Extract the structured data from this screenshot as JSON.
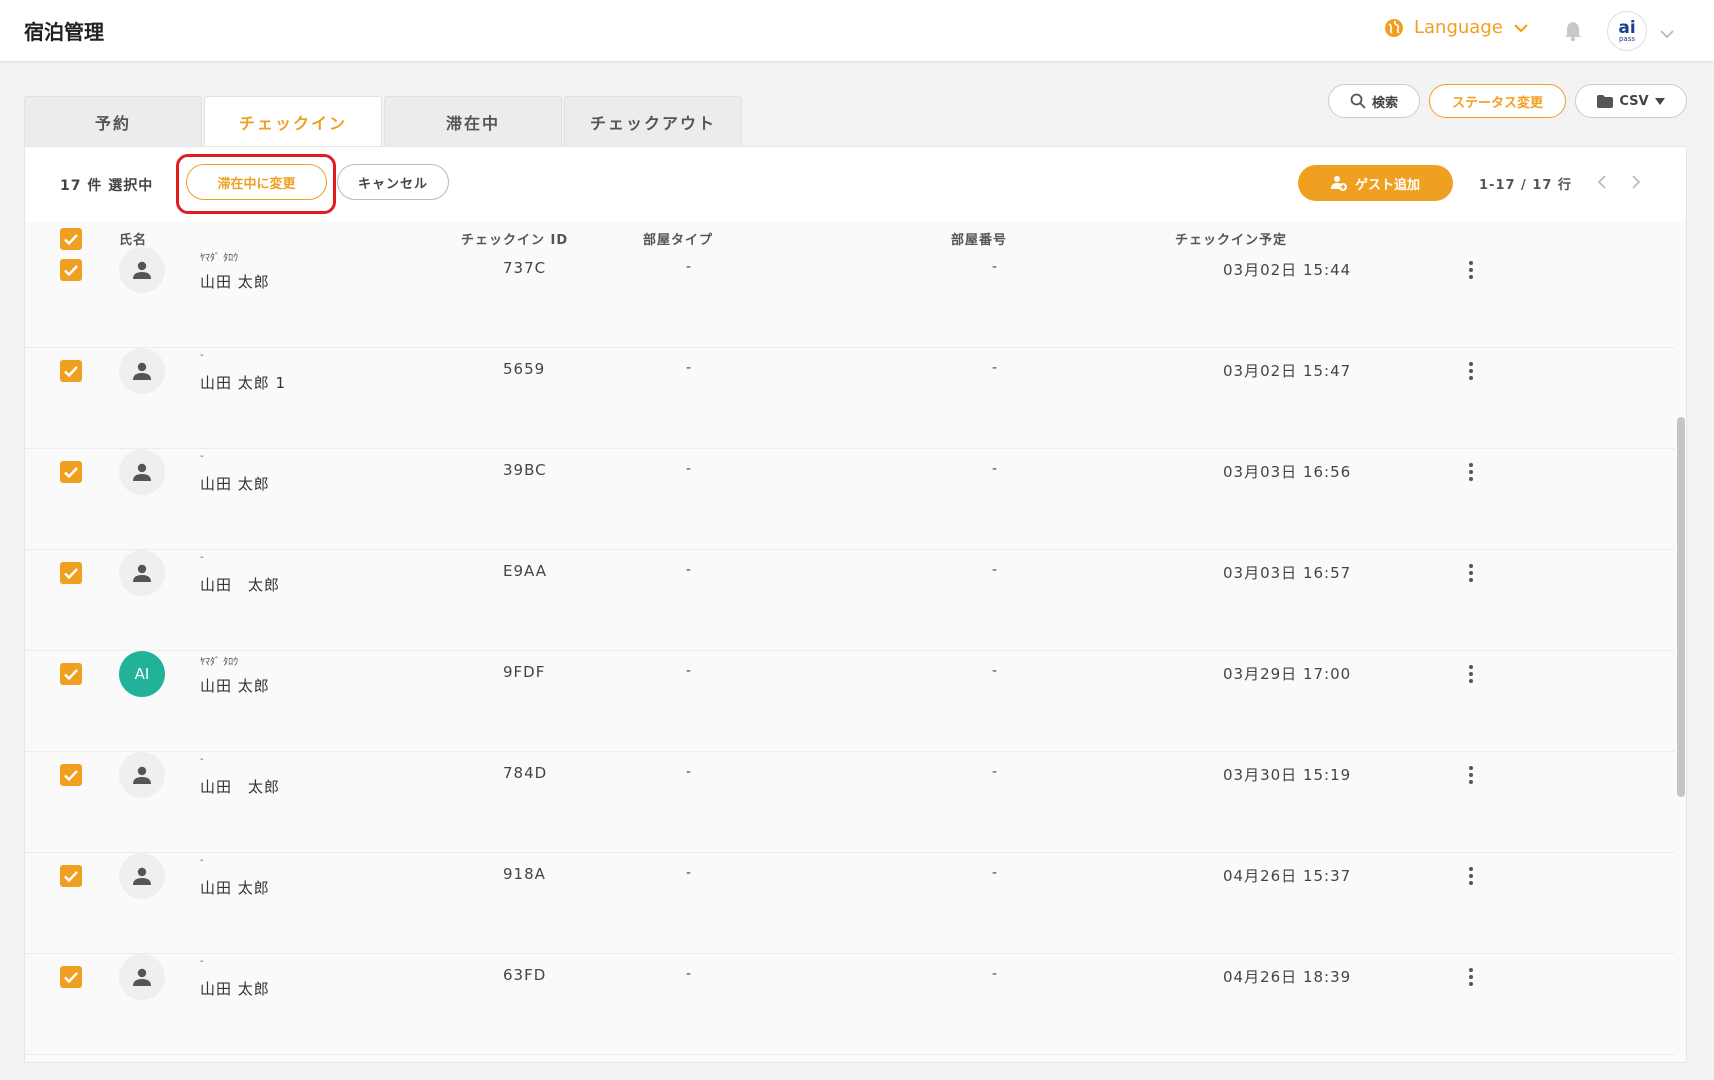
{
  "header": {
    "title": "宿泊管理",
    "language_label": "Language",
    "logo_text": "ai",
    "logo_sub": "pass"
  },
  "tabs": [
    {
      "label": "予約",
      "active": false
    },
    {
      "label": "チェックイン",
      "active": true
    },
    {
      "label": "滞在中",
      "active": false
    },
    {
      "label": "チェックアウト",
      "active": false
    }
  ],
  "top_actions": {
    "search_label": "検索",
    "status_change_label": "ステータス変更",
    "csv_label": "CSV"
  },
  "action_bar": {
    "selected_count": "17 件 選択中",
    "change_to_staying_label": "滞在中に変更",
    "cancel_label": "キャンセル",
    "add_guest_label": "ゲスト追加",
    "pagination": "1-17 / 17 行"
  },
  "table": {
    "columns": {
      "name": "氏名",
      "checkin_id": "チェックイン ID",
      "room_type": "部屋タイプ",
      "room_number": "部屋番号",
      "checkin_planned": "チェックイン予定"
    },
    "rows": [
      {
        "kana": "ﾔﾏﾀﾞ ﾀﾛｳ",
        "name": "山田 太郎",
        "avatar": "",
        "checkin_id": "737C",
        "room_type": "-",
        "room_number": "-",
        "checkin_planned": "03月02日 15:44"
      },
      {
        "kana": "-",
        "name": "山田 太郎 1",
        "avatar": "",
        "checkin_id": "5659",
        "room_type": "-",
        "room_number": "-",
        "checkin_planned": "03月02日 15:47"
      },
      {
        "kana": "-",
        "name": "山田 太郎",
        "avatar": "",
        "checkin_id": "39BC",
        "room_type": "-",
        "room_number": "-",
        "checkin_planned": "03月03日 16:56"
      },
      {
        "kana": "-",
        "name": "山田　太郎",
        "avatar": "",
        "checkin_id": "E9AA",
        "room_type": "-",
        "room_number": "-",
        "checkin_planned": "03月03日 16:57"
      },
      {
        "kana": "ﾔﾏﾀﾞ ﾀﾛｳ",
        "name": "山田 太郎",
        "avatar": "AI",
        "checkin_id": "9FDF",
        "room_type": "-",
        "room_number": "-",
        "checkin_planned": "03月29日 17:00"
      },
      {
        "kana": "-",
        "name": "山田　太郎",
        "avatar": "",
        "checkin_id": "784D",
        "room_type": "-",
        "room_number": "-",
        "checkin_planned": "03月30日 15:19"
      },
      {
        "kana": "-",
        "name": "山田 太郎",
        "avatar": "",
        "checkin_id": "918A",
        "room_type": "-",
        "room_number": "-",
        "checkin_planned": "04月26日 15:37"
      },
      {
        "kana": "-",
        "name": "山田 太郎",
        "avatar": "",
        "checkin_id": "63FD",
        "room_type": "-",
        "room_number": "-",
        "checkin_planned": "04月26日 18:39"
      }
    ]
  },
  "colors": {
    "accent": "#f0a020",
    "highlight": "#e31b1b",
    "avatar_initials_bg": "#20b39a"
  }
}
